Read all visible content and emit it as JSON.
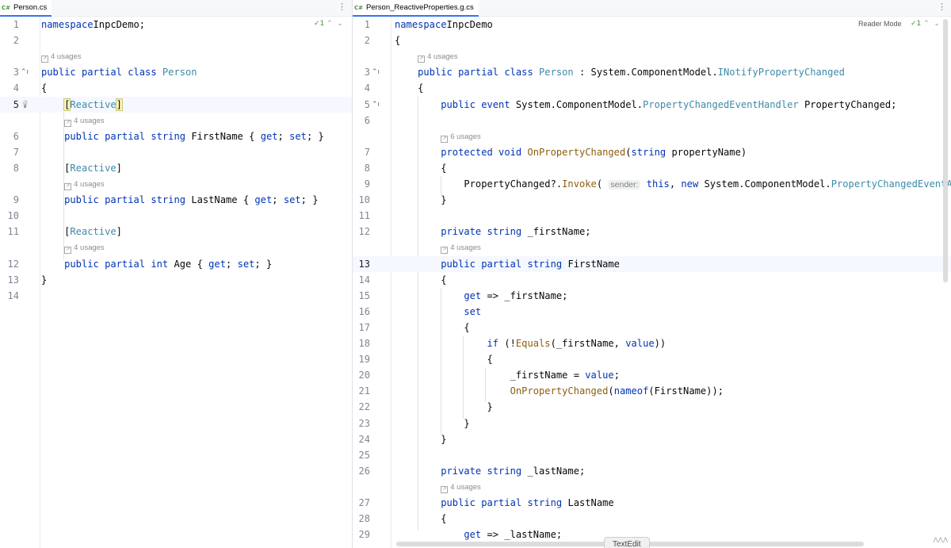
{
  "left": {
    "tab_label": "Person.cs",
    "file_icon": "C#",
    "inspection": {
      "count": "1",
      "arrows": "⌃  ⌄"
    },
    "lines": [
      {
        "type": "code",
        "num": "1",
        "current": false,
        "tokens": [
          [
            "k",
            "namespace"
          ],
          [
            "",
            "InpcDemo;"
          ]
        ]
      },
      {
        "type": "code",
        "num": "2",
        "current": false,
        "tokens": []
      },
      {
        "type": "hint",
        "text": "4 usages"
      },
      {
        "type": "code",
        "num": "3",
        "current": false,
        "gutter": "arrow",
        "tokens": [
          [
            "k",
            "public partial class "
          ],
          [
            "t",
            "Person"
          ]
        ]
      },
      {
        "type": "code",
        "num": "4",
        "current": false,
        "tokens": [
          [
            "",
            "{"
          ]
        ]
      },
      {
        "type": "code",
        "num": "5",
        "current": true,
        "gutter": "bulb",
        "tokens": [
          [
            "",
            "    "
          ],
          [
            "bh",
            "["
          ],
          [
            "t",
            "Reactive"
          ],
          [
            "bh",
            "]"
          ]
        ]
      },
      {
        "type": "hint",
        "text": "4 usages",
        "indent": 4
      },
      {
        "type": "code",
        "num": "6",
        "current": false,
        "tokens": [
          [
            "",
            "    "
          ],
          [
            "k",
            "public partial string "
          ],
          [
            "",
            "FirstName { "
          ],
          [
            "k",
            "get"
          ],
          [
            "",
            "; "
          ],
          [
            "k",
            "set"
          ],
          [
            "",
            "; }"
          ]
        ]
      },
      {
        "type": "code",
        "num": "7",
        "current": false,
        "tokens": []
      },
      {
        "type": "code",
        "num": "8",
        "current": false,
        "tokens": [
          [
            "",
            "    ["
          ],
          [
            "t",
            "Reactive"
          ],
          [
            "",
            "]"
          ]
        ]
      },
      {
        "type": "hint",
        "text": "4 usages",
        "indent": 4
      },
      {
        "type": "code",
        "num": "9",
        "current": false,
        "tokens": [
          [
            "",
            "    "
          ],
          [
            "k",
            "public partial string "
          ],
          [
            "",
            "LastName { "
          ],
          [
            "k",
            "get"
          ],
          [
            "",
            "; "
          ],
          [
            "k",
            "set"
          ],
          [
            "",
            "; }"
          ]
        ]
      },
      {
        "type": "code",
        "num": "10",
        "current": false,
        "tokens": []
      },
      {
        "type": "code",
        "num": "11",
        "current": false,
        "tokens": [
          [
            "",
            "    ["
          ],
          [
            "t",
            "Reactive"
          ],
          [
            "",
            "]"
          ]
        ]
      },
      {
        "type": "hint",
        "text": "4 usages",
        "indent": 4
      },
      {
        "type": "code",
        "num": "12",
        "current": false,
        "tokens": [
          [
            "",
            "    "
          ],
          [
            "k",
            "public partial int "
          ],
          [
            "",
            "Age { "
          ],
          [
            "k",
            "get"
          ],
          [
            "",
            "; "
          ],
          [
            "k",
            "set"
          ],
          [
            "",
            "; }"
          ]
        ]
      },
      {
        "type": "code",
        "num": "13",
        "current": false,
        "tokens": [
          [
            "",
            "}"
          ]
        ]
      },
      {
        "type": "code",
        "num": "14",
        "current": false,
        "tokens": []
      }
    ]
  },
  "right": {
    "tab_label": "Person_ReactiveProperties.g.cs",
    "file_icon": "C#",
    "reader_mode": "Reader Mode",
    "inspection": {
      "count": "1",
      "arrows": "⌃  ⌄"
    },
    "status_text": "TextEdit",
    "lines": [
      {
        "type": "code",
        "num": "1",
        "current": false,
        "tokens": [
          [
            "k",
            "namespace"
          ],
          [
            "",
            "InpcDemo"
          ]
        ]
      },
      {
        "type": "code",
        "num": "2",
        "current": false,
        "tokens": [
          [
            "",
            "{"
          ]
        ]
      },
      {
        "type": "hint",
        "text": "4 usages",
        "indent": 4
      },
      {
        "type": "code",
        "num": "3",
        "current": false,
        "gutter": "arrow",
        "tokens": [
          [
            "",
            "    "
          ],
          [
            "k",
            "public partial class "
          ],
          [
            "t",
            "Person"
          ],
          [
            "",
            " : System.ComponentModel."
          ],
          [
            "t",
            "INotifyPropertyChanged"
          ]
        ]
      },
      {
        "type": "code",
        "num": "4",
        "current": false,
        "tokens": [
          [
            "",
            "    {"
          ]
        ]
      },
      {
        "type": "code",
        "num": "5",
        "current": false,
        "gutter": "arrow",
        "tokens": [
          [
            "",
            "        "
          ],
          [
            "k",
            "public event "
          ],
          [
            "",
            "System.ComponentModel."
          ],
          [
            "t",
            "PropertyChangedEventHandler"
          ],
          [
            "",
            " PropertyChanged;"
          ]
        ]
      },
      {
        "type": "code",
        "num": "6",
        "current": false,
        "tokens": []
      },
      {
        "type": "hint",
        "text": "6 usages",
        "indent": 8
      },
      {
        "type": "code",
        "num": "7",
        "current": false,
        "tokens": [
          [
            "",
            "        "
          ],
          [
            "k",
            "protected void "
          ],
          [
            "m",
            "OnPropertyChanged"
          ],
          [
            "",
            "("
          ],
          [
            "k",
            "string "
          ],
          [
            "",
            "propertyName)"
          ]
        ]
      },
      {
        "type": "code",
        "num": "8",
        "current": false,
        "tokens": [
          [
            "",
            "        {"
          ]
        ]
      },
      {
        "type": "code",
        "num": "9",
        "current": false,
        "tokens": [
          [
            "",
            "            PropertyChanged?."
          ],
          [
            "m",
            "Invoke"
          ],
          [
            "",
            "( "
          ],
          [
            "in",
            "sender:"
          ],
          [
            "",
            " "
          ],
          [
            "k",
            "this"
          ],
          [
            "",
            ", "
          ],
          [
            "k",
            "new "
          ],
          [
            "",
            "System.ComponentModel."
          ],
          [
            "t",
            "PropertyChangedEventArgs"
          ]
        ]
      },
      {
        "type": "code",
        "num": "10",
        "current": false,
        "tokens": [
          [
            "",
            "        }"
          ]
        ]
      },
      {
        "type": "code",
        "num": "11",
        "current": false,
        "tokens": []
      },
      {
        "type": "code",
        "num": "12",
        "current": false,
        "tokens": [
          [
            "",
            "        "
          ],
          [
            "k",
            "private string "
          ],
          [
            "",
            "_firstName;"
          ]
        ]
      },
      {
        "type": "hint",
        "text": "4 usages",
        "indent": 8
      },
      {
        "type": "code",
        "num": "13",
        "current": true,
        "tokens": [
          [
            "",
            "        "
          ],
          [
            "k",
            "public partial string "
          ],
          [
            "",
            "FirstName"
          ]
        ]
      },
      {
        "type": "code",
        "num": "14",
        "current": false,
        "tokens": [
          [
            "",
            "        {"
          ]
        ]
      },
      {
        "type": "code",
        "num": "15",
        "current": false,
        "tokens": [
          [
            "",
            "            "
          ],
          [
            "k",
            "get"
          ],
          [
            "",
            " => _firstName;"
          ]
        ]
      },
      {
        "type": "code",
        "num": "16",
        "current": false,
        "tokens": [
          [
            "",
            "            "
          ],
          [
            "k",
            "set"
          ]
        ]
      },
      {
        "type": "code",
        "num": "17",
        "current": false,
        "tokens": [
          [
            "",
            "            {"
          ]
        ]
      },
      {
        "type": "code",
        "num": "18",
        "current": false,
        "tokens": [
          [
            "",
            "                "
          ],
          [
            "k",
            "if "
          ],
          [
            "",
            "(!"
          ],
          [
            "m",
            "Equals"
          ],
          [
            "",
            "(_firstName, "
          ],
          [
            "k",
            "value"
          ],
          [
            "",
            "))"
          ]
        ]
      },
      {
        "type": "code",
        "num": "19",
        "current": false,
        "tokens": [
          [
            "",
            "                {"
          ]
        ]
      },
      {
        "type": "code",
        "num": "20",
        "current": false,
        "tokens": [
          [
            "",
            "                    _firstName = "
          ],
          [
            "k",
            "value"
          ],
          [
            "",
            ";"
          ]
        ]
      },
      {
        "type": "code",
        "num": "21",
        "current": false,
        "tokens": [
          [
            "",
            "                    "
          ],
          [
            "m",
            "OnPropertyChanged"
          ],
          [
            "",
            "("
          ],
          [
            "k",
            "nameof"
          ],
          [
            "",
            "(FirstName));"
          ]
        ]
      },
      {
        "type": "code",
        "num": "22",
        "current": false,
        "tokens": [
          [
            "",
            "                }"
          ]
        ]
      },
      {
        "type": "code",
        "num": "23",
        "current": false,
        "tokens": [
          [
            "",
            "            }"
          ]
        ]
      },
      {
        "type": "code",
        "num": "24",
        "current": false,
        "tokens": [
          [
            "",
            "        }"
          ]
        ]
      },
      {
        "type": "code",
        "num": "25",
        "current": false,
        "tokens": []
      },
      {
        "type": "code",
        "num": "26",
        "current": false,
        "tokens": [
          [
            "",
            "        "
          ],
          [
            "k",
            "private string "
          ],
          [
            "",
            "_lastName;"
          ]
        ]
      },
      {
        "type": "hint",
        "text": "4 usages",
        "indent": 8
      },
      {
        "type": "code",
        "num": "27",
        "current": false,
        "tokens": [
          [
            "",
            "        "
          ],
          [
            "k",
            "public partial string "
          ],
          [
            "",
            "LastName"
          ]
        ]
      },
      {
        "type": "code",
        "num": "28",
        "current": false,
        "tokens": [
          [
            "",
            "        {"
          ]
        ]
      },
      {
        "type": "code",
        "num": "29",
        "current": false,
        "tokens": [
          [
            "",
            "            "
          ],
          [
            "k",
            "get"
          ],
          [
            "",
            " => _lastName;"
          ]
        ]
      }
    ]
  }
}
